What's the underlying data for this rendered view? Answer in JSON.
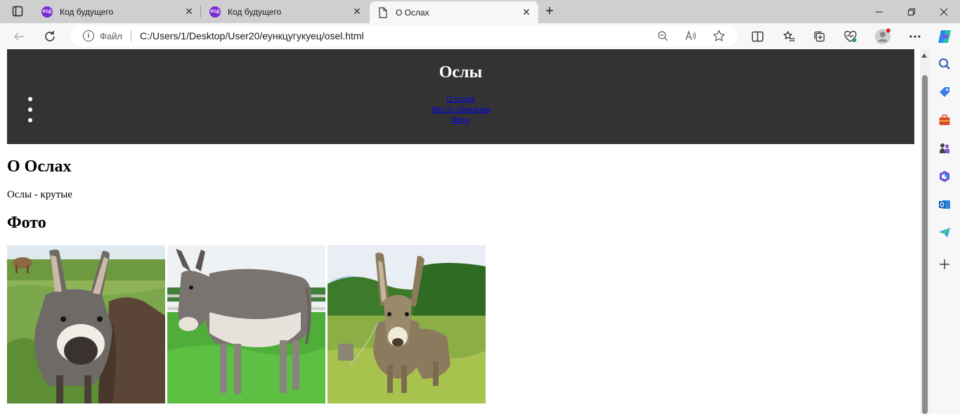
{
  "browser": {
    "tabs": [
      {
        "title": "Код будущего",
        "favicon": "kod-logo-icon",
        "active": false
      },
      {
        "title": "Код будущего",
        "favicon": "kod-logo-icon",
        "active": false
      },
      {
        "title": "О Ослах",
        "favicon": "page-icon",
        "active": true
      }
    ],
    "favicon_text": "КОД",
    "address": {
      "label": "Файл",
      "url": "C:/Users/1/Desktop/User20/еункцугукуец/osel.html"
    },
    "close_glyph": "✕",
    "new_tab_glyph": "+",
    "window_controls": {
      "minimize": "—",
      "maximize": "❐",
      "close": "✕"
    }
  },
  "page": {
    "header_title": "Ослы",
    "nav": [
      {
        "label": "О ослах"
      },
      {
        "label": "Место обитания"
      },
      {
        "label": "Фото"
      }
    ],
    "about_heading": "О Ослах",
    "about_text": "Ослы - крутые",
    "photo_heading": "Фото",
    "photos": [
      "donkey-photo-1",
      "donkey-photo-2",
      "donkey-photo-3"
    ]
  },
  "colors": {
    "header_bg": "#333333",
    "link": "#0000ee",
    "accent": "#0078d4"
  }
}
